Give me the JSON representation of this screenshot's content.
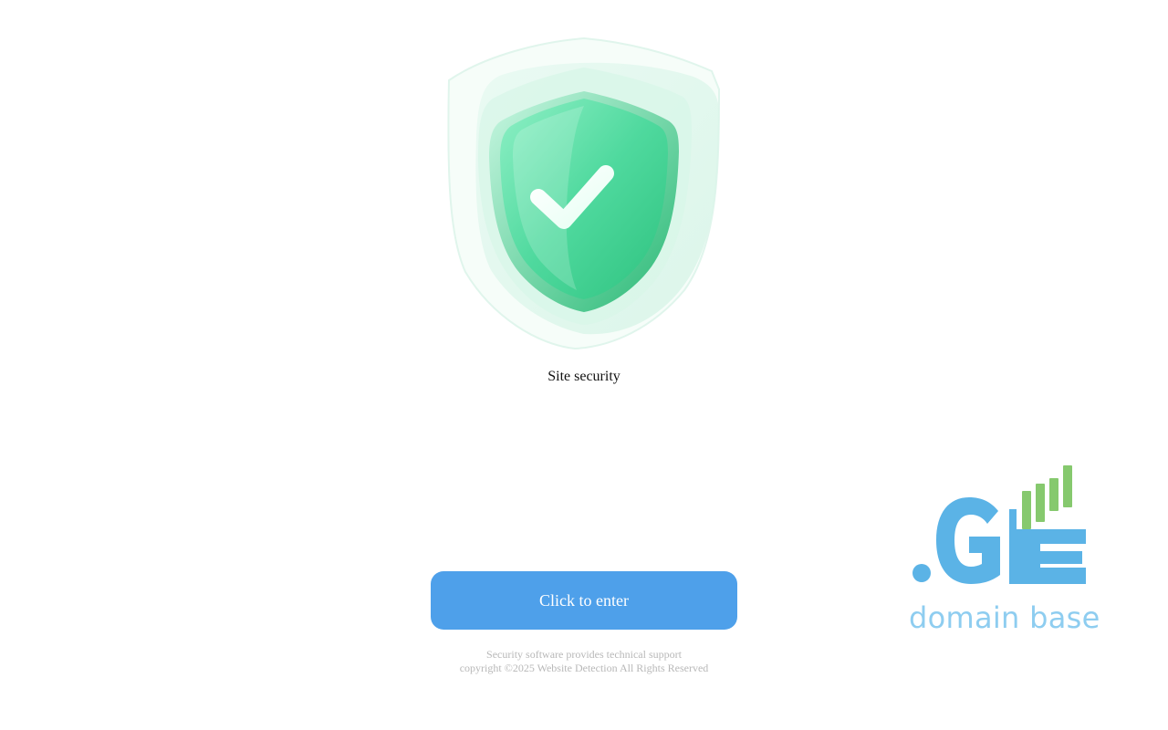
{
  "hero": {
    "icon": "shield-check-icon",
    "title": "Site security"
  },
  "action": {
    "enter_label": "Click to enter",
    "color": "#4ea0ea"
  },
  "footer": {
    "line1": "Security software provides technical support",
    "line2": "copyright ©2025 Website Detection All Rights Reserved"
  },
  "brand": {
    "logo_text": ".GE",
    "wordmark": "domain base",
    "logo_color": "#5bb3e6",
    "wordmark_color": "#8ecdf0",
    "bars_color": "#86c96e"
  }
}
